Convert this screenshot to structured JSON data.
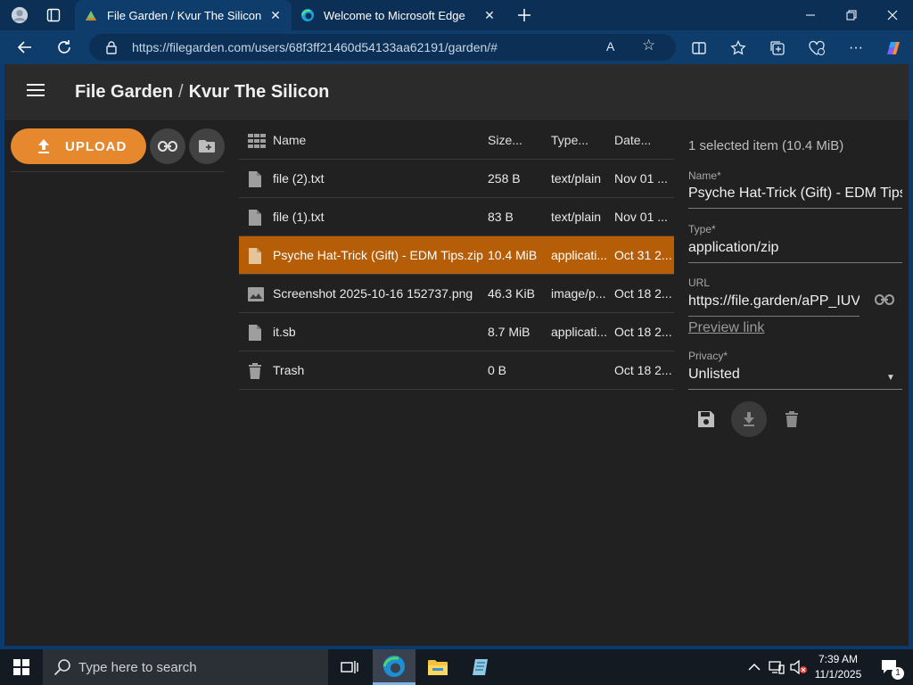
{
  "browser": {
    "tabs": [
      {
        "title": "File Garden / Kvur The Silicon",
        "active": true
      },
      {
        "title": "Welcome to Microsoft Edge",
        "active": false
      }
    ],
    "url": "https://filegarden.com/users/68f3ff21460d54133aa62191/garden/#",
    "accent": "#0f3d6b"
  },
  "app": {
    "title": "File Garden",
    "title_sep": "/",
    "subtitle": "Kvur The Silicon",
    "upload_label": "UPLOAD",
    "accent": "#e6882e",
    "selected_row_color": "#b65e07"
  },
  "filelist": {
    "headers": {
      "name": "Name",
      "size": "Size...",
      "type": "Type...",
      "date": "Date..."
    },
    "rows": [
      {
        "icon": "file-icon",
        "name": "file (2).txt",
        "size": "258 B",
        "type": "text/plain",
        "date": "Nov 01 ...",
        "selected": false
      },
      {
        "icon": "file-icon",
        "name": "file (1).txt",
        "size": "83 B",
        "type": "text/plain",
        "date": "Nov 01 ...",
        "selected": false
      },
      {
        "icon": "file-icon",
        "name": "Psyche Hat-Trick (Gift) - EDM Tips.zip",
        "size": "10.4 MiB",
        "type": "applicati...",
        "date": "Oct 31 2...",
        "selected": true
      },
      {
        "icon": "image-icon",
        "name": "Screenshot 2025-10-16 152737.png",
        "size": "46.3 KiB",
        "type": "image/p...",
        "date": "Oct 18 2...",
        "selected": false
      },
      {
        "icon": "file-icon",
        "name": "it.sb",
        "size": "8.7 MiB",
        "type": "applicati...",
        "date": "Oct 18 2...",
        "selected": false
      },
      {
        "icon": "trash-icon",
        "name": "Trash",
        "size": "0 B",
        "type": "",
        "date": "Oct 18 2...",
        "selected": false
      }
    ]
  },
  "details": {
    "selection": "1 selected item (10.4 MiB)",
    "name_label": "Name*",
    "name_value": "Psyche Hat-Trick (Gift) - EDM Tips.zip",
    "type_label": "Type*",
    "type_value": "application/zip",
    "url_label": "URL",
    "url_value": "https://file.garden/aPP_IUV",
    "preview_link": "Preview link",
    "privacy_label": "Privacy*",
    "privacy_value": "Unlisted"
  },
  "taskbar": {
    "search_placeholder": "Type here to search",
    "time": "7:39 AM",
    "date": "11/1/2025",
    "notification_count": "1"
  }
}
